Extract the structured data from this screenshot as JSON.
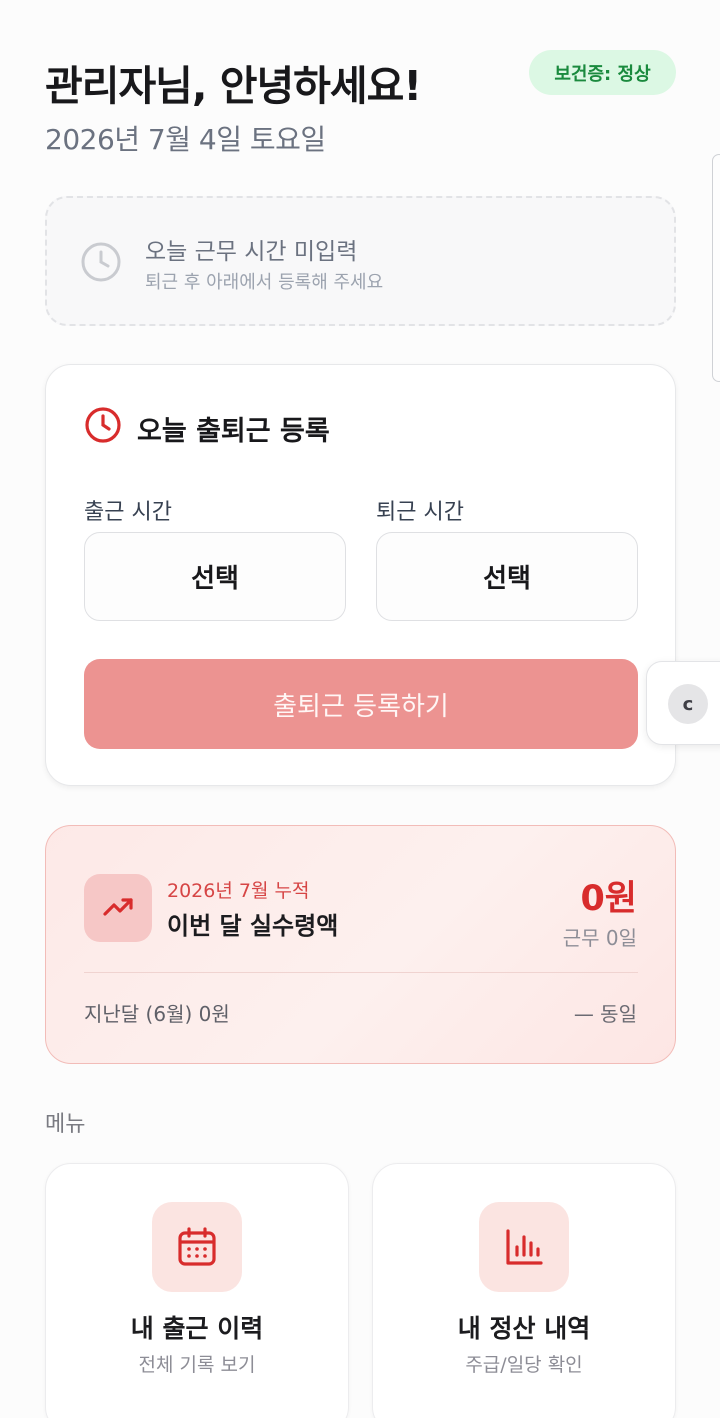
{
  "header": {
    "greeting": "관리자님, 안녕하세요!",
    "date": "2026년 7월 4일 토요일",
    "health_badge": "보건증: 정상"
  },
  "notice": {
    "title": "오늘 근무 시간 미입력",
    "subtitle": "퇴근 후 아래에서 등록해 주세요"
  },
  "registration": {
    "title": "오늘 출퇴근 등록",
    "clock_in_label": "출근 시간",
    "clock_out_label": "퇴근 시간",
    "clock_in_value": "선택",
    "clock_out_value": "선택",
    "submit_label": "출퇴근 등록하기"
  },
  "floating": {
    "button_label": "c"
  },
  "pay_summary": {
    "period": "2026년 7월 누적",
    "title": "이번 달 실수령액",
    "amount": "0원",
    "work_days": "근무 0일",
    "previous": "지난달 (6월) 0원",
    "compare": "— 동일"
  },
  "menu": {
    "section_title": "메뉴",
    "items": [
      {
        "label": "내 출근 이력",
        "sub": "전체 기록 보기",
        "icon": "calendar-icon"
      },
      {
        "label": "내 정산 내역",
        "sub": "주급/일당 확인",
        "icon": "bar-chart-icon"
      }
    ]
  },
  "colors": {
    "accent": "#d82c2c",
    "submit_bg": "#ec9391",
    "badge_bg": "#dcf8e4",
    "badge_text": "#1a8a3e"
  }
}
